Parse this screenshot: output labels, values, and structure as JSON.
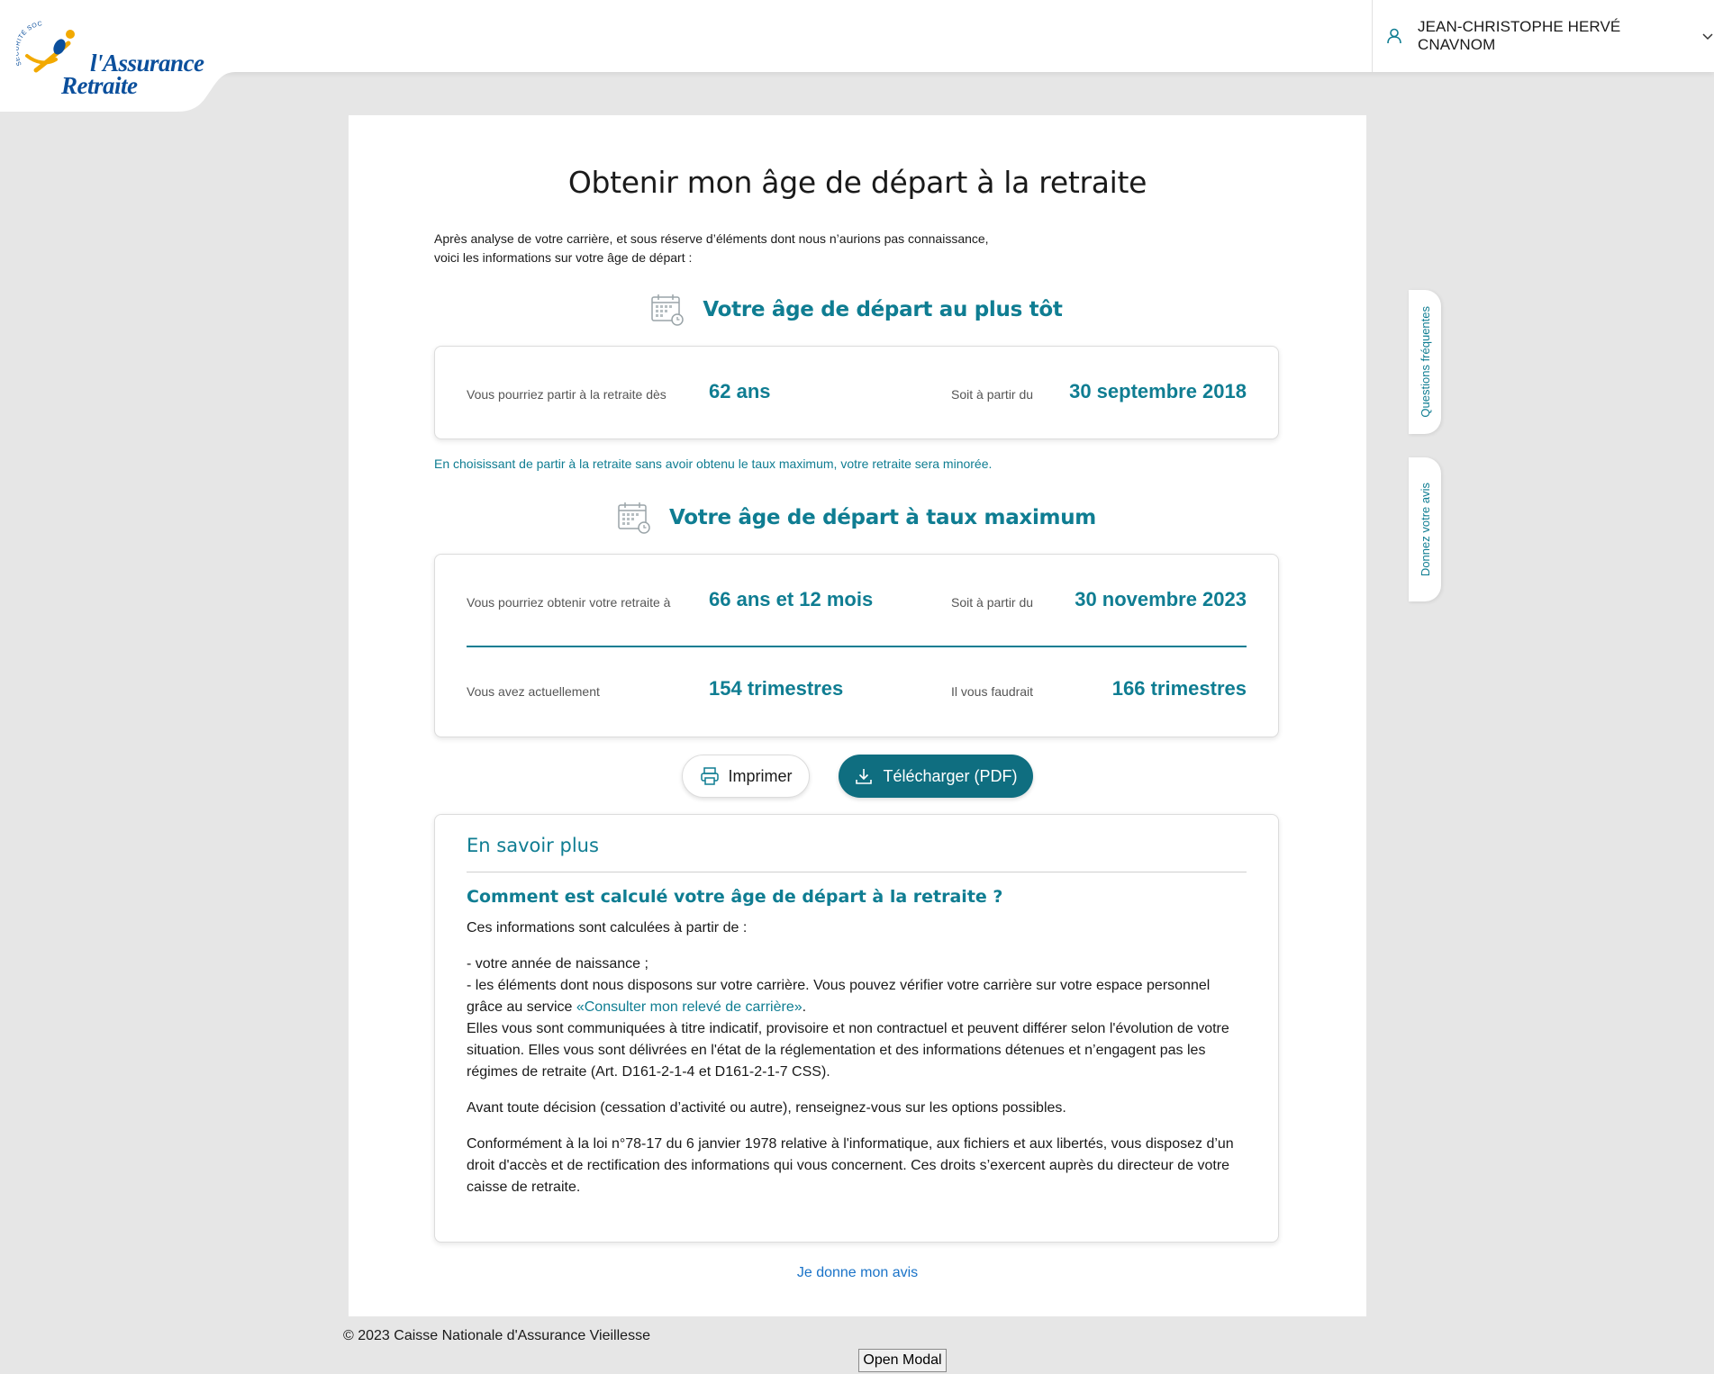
{
  "header": {
    "logo_small": "SÉCURITÉ SOCIALE",
    "logo_line1": "l'Assurance",
    "logo_line2": "Retraite",
    "user_name": "JEAN-CHRISTOPHE HERVÉ CNAVNOM",
    "user_icon": "user-icon",
    "menu_icon": "chevron-down-icon"
  },
  "page": {
    "title": "Obtenir mon âge de départ à la retraite",
    "intro_line1": "Après analyse de votre carrière, et sous réserve d’éléments dont nous n’aurions pas connaissance,",
    "intro_line2": "voici les informations sur votre âge de départ :"
  },
  "earliest": {
    "heading": "Votre âge de départ au plus tôt",
    "age_label": "Vous pourriez partir à la retraite dès",
    "age_value": "62 ans",
    "date_label": "Soit à partir du",
    "date_value": "30 septembre 2018",
    "warning": "En choisissant de partir à la retraite sans avoir obtenu le taux maximum, votre retraite sera minorée."
  },
  "maximum": {
    "heading": "Votre âge de départ à taux maximum",
    "age_label": "Vous pourriez obtenir votre retraite à",
    "age_value": "66 ans et 12 mois",
    "date_label": "Soit à partir du",
    "date_value": "30 novembre 2023",
    "current_label": "Vous avez actuellement",
    "current_value": "154 trimestres",
    "needed_label": "Il vous faudrait",
    "needed_value": "166 trimestres"
  },
  "actions": {
    "print_label": "Imprimer",
    "download_label": "Télécharger (PDF)"
  },
  "info": {
    "title": "En savoir plus",
    "question": "Comment est calculé votre âge de départ à la retraite ?",
    "p1": "Ces informations sont calculées à partir de :",
    "item1": "- votre année de naissance ;",
    "item2_pre": "- les éléments dont nous disposons sur votre carrière. Vous pouvez vérifier votre carrière sur votre espace personnel grâce au service ",
    "item2_link": "«Consulter mon relevé de carrière»",
    "item2_post": ".",
    "p2": "Elles vous sont communiquées à titre indicatif, provisoire et non contractuel et peuvent différer selon l'évolution de votre situation. Elles vous sont délivrées en l'état de la réglementation et des informations détenues et n’engagent pas les régimes de retraite (Art. D161-2-1-4 et D161-2-1-7 CSS).",
    "p3": "Avant toute décision (cessation d’activité ou autre), renseignez-vous sur les options possibles.",
    "p4": "Conformément à la loi n°78-17 du 6 janvier 1978 relative à l'informatique, aux fichiers et aux libertés, vous disposez d’un droit d'accès et de rectification des informations qui vous concernent. Ces droits s’exercent auprès du directeur de votre caisse de retraite."
  },
  "feedback_link": "Je donne mon avis",
  "side_tabs": {
    "faq": "Questions fréquentes",
    "avis": "Donnez votre avis"
  },
  "footer": {
    "copyright": "© 2023 Caisse Nationale d'Assurance Vieillesse",
    "modal_button": "Open Modal"
  },
  "colors": {
    "accent": "#0f7d92",
    "button_primary": "#0f6e80",
    "logo_blue": "#0b4f9c",
    "logo_yellow": "#f2a900"
  }
}
